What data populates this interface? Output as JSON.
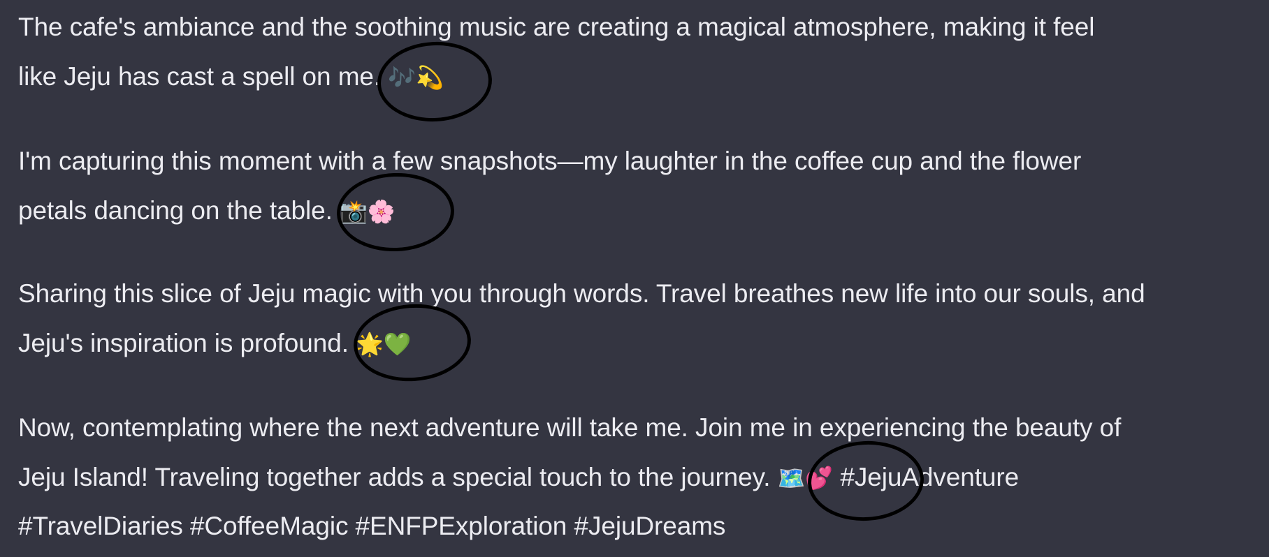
{
  "paragraphs": [
    {
      "lines": [
        "The cafe's ambiance and the soothing music are creating a magical atmosphere, making it feel",
        "like Jeju has cast a spell on me."
      ],
      "emoji": "🎶💫"
    },
    {
      "lines": [
        "I'm capturing this moment with a few snapshots—my laughter in the coffee cup and the flower",
        "petals dancing on the table."
      ],
      "emoji": "📸🌸"
    },
    {
      "lines": [
        "Sharing this slice of Jeju magic with you through words. Travel breathes new life into our souls, and",
        "Jeju's inspiration is profound."
      ],
      "emoji": "🌟💚"
    },
    {
      "lines": [
        "Now, contemplating where the next adventure will take me. Join me in experiencing the beauty of",
        "Jeju Island! Traveling together adds a special touch to the journey."
      ],
      "emoji": "🗺️💕",
      "hashtags_inline": "#JejuAdventure",
      "hashtags_line": "#TravelDiaries #CoffeeMagic #ENFPExploration #JejuDreams"
    }
  ],
  "annotation_color": "#000000",
  "background_color": "#343541",
  "text_color": "#ececf1"
}
